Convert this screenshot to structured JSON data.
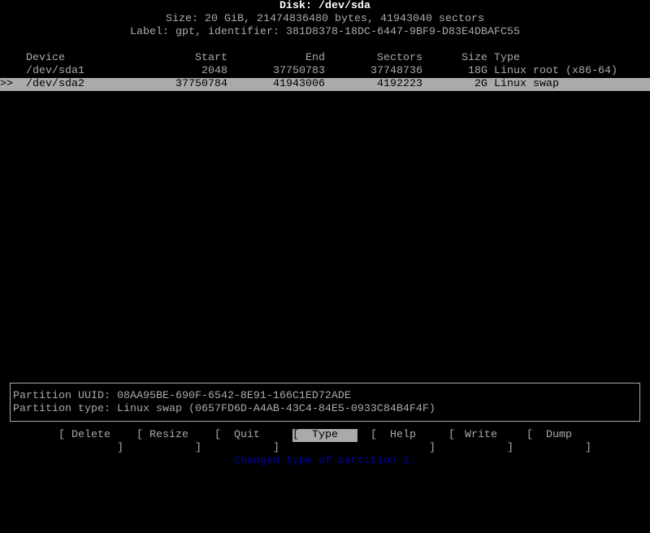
{
  "header": {
    "title": "Disk: /dev/sda",
    "size_line": "Size: 20 GiB, 21474836480 bytes, 41943040 sectors",
    "label_line": "Label: gpt, identifier: 381D8378-18DC-6447-9BF9-D83E4DBAFC55"
  },
  "table": {
    "columns": [
      "Device",
      "Start",
      "End",
      "Sectors",
      "Size",
      "Type"
    ],
    "rows": [
      {
        "marker": "",
        "device": "/dev/sda1",
        "start": "2048",
        "end": "37750783",
        "sectors": "37748736",
        "size": "18G",
        "type": "Linux root (x86-64)",
        "selected": false
      },
      {
        "marker": ">>",
        "device": "/dev/sda2",
        "start": "37750784",
        "end": "41943006",
        "sectors": "4192223",
        "size": "2G",
        "type": "Linux swap",
        "selected": true
      }
    ]
  },
  "info": {
    "uuid_line": "Partition UUID: 08AA95BE-690F-6542-8E91-166C1ED72ADE",
    "type_line": "Partition type: Linux swap (0657FD6D-A4AB-43C4-84E5-0933C84B4F4F)"
  },
  "menu": {
    "open_bracket": "[",
    "close_bracket": "]",
    "buttons": [
      "Delete",
      "Resize",
      "Quit",
      "Type",
      "Help",
      "Write",
      "Dump"
    ],
    "active": "Type"
  },
  "status": "Changed type of partition 2.",
  "colors": {
    "background": "#000000",
    "text": "#aaaaaa",
    "highlight": "#aaaaaa",
    "status": "#0000aa"
  }
}
